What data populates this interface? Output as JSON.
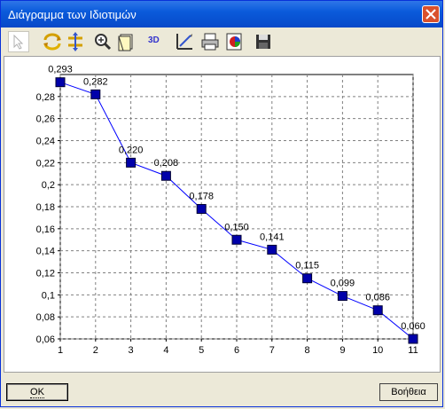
{
  "window": {
    "title": "Διάγραμμα των Ιδιοτιμών"
  },
  "toolbar": {
    "items": [
      {
        "name": "pointer-icon"
      },
      {
        "name": "rotate-icon"
      },
      {
        "name": "move-icon"
      },
      {
        "name": "zoom-icon"
      },
      {
        "name": "page-icon"
      },
      {
        "name": "3d-button",
        "label": "3D"
      },
      {
        "name": "edit-chart-icon"
      },
      {
        "name": "print-icon"
      },
      {
        "name": "color-palette-icon"
      },
      {
        "name": "save-icon"
      }
    ]
  },
  "buttons": {
    "ok": "OK",
    "help": "Βοήθεια"
  },
  "chart_data": {
    "type": "line",
    "title": "",
    "xlabel": "",
    "ylabel": "",
    "x": [
      1,
      2,
      3,
      4,
      5,
      6,
      7,
      8,
      9,
      10,
      11
    ],
    "values": [
      0.293,
      0.282,
      0.22,
      0.208,
      0.178,
      0.15,
      0.141,
      0.115,
      0.099,
      0.086,
      0.06
    ],
    "data_labels": [
      "0,293",
      "0,282",
      "0,220",
      "0,208",
      "0,178",
      "0,150",
      "0,141",
      "0,115",
      "0,099",
      "0,086",
      "0,060"
    ],
    "y_tick_labels": [
      "0,06",
      "0,08",
      "0,1",
      "0,12",
      "0,14",
      "0,16",
      "0,18",
      "0,2",
      "0,22",
      "0,24",
      "0,26",
      "0,28"
    ],
    "y_ticks": [
      0.06,
      0.08,
      0.1,
      0.12,
      0.14,
      0.16,
      0.18,
      0.2,
      0.22,
      0.24,
      0.26,
      0.28
    ],
    "x_tick_labels": [
      "1",
      "2",
      "3",
      "4",
      "5",
      "6",
      "7",
      "8",
      "9",
      "10",
      "11"
    ],
    "xlim": [
      1,
      11
    ],
    "ylim": [
      0.06,
      0.3
    ],
    "grid": true,
    "line_color": "#0000ff",
    "marker_color": "#0000aa"
  }
}
